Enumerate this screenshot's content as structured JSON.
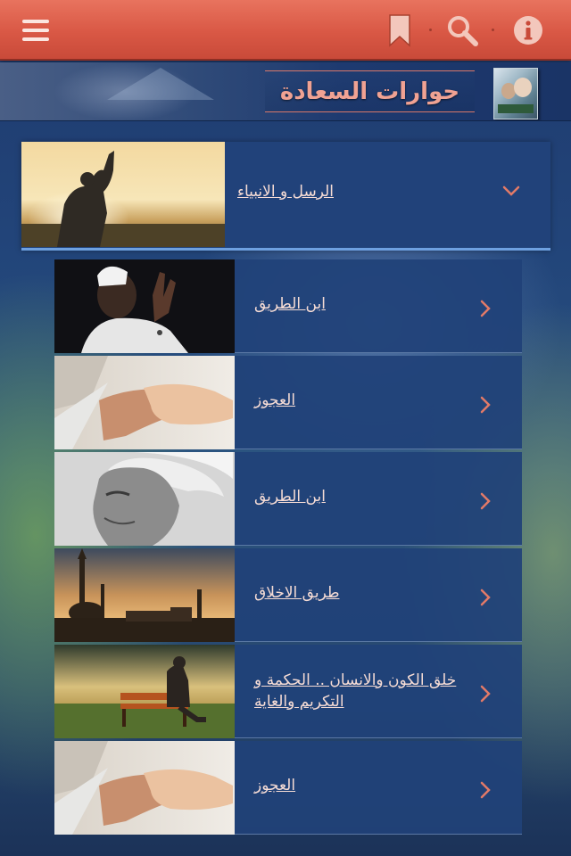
{
  "toolbar": {
    "icons": [
      "menu-icon",
      "bookmark-icon",
      "search-icon",
      "info-icon"
    ]
  },
  "banner": {
    "title": "حوارات السعادة"
  },
  "section": {
    "label": "الرسل و الانبياء",
    "expanded": true
  },
  "items": [
    {
      "label": "ابن الطريق",
      "thumb": "man-praying-photo"
    },
    {
      "label": "العجوز",
      "thumb": "holding-hands-photo"
    },
    {
      "label": "ابن الطريق",
      "thumb": "old-man-portrait-photo"
    },
    {
      "label": "طريق الاخلاق",
      "thumb": "mosque-skyline-photo"
    },
    {
      "label": "خلق الكون والانسان .. الحكمة و التكريم والغاية",
      "thumb": "bench-sunset-photo"
    },
    {
      "label": "العجوز",
      "thumb": "holding-hands-photo"
    }
  ],
  "colors": {
    "toolbar": "#d95845",
    "accent_text": "#f0a293",
    "item_bg": "#20427a",
    "chevron": "#e27a68"
  }
}
